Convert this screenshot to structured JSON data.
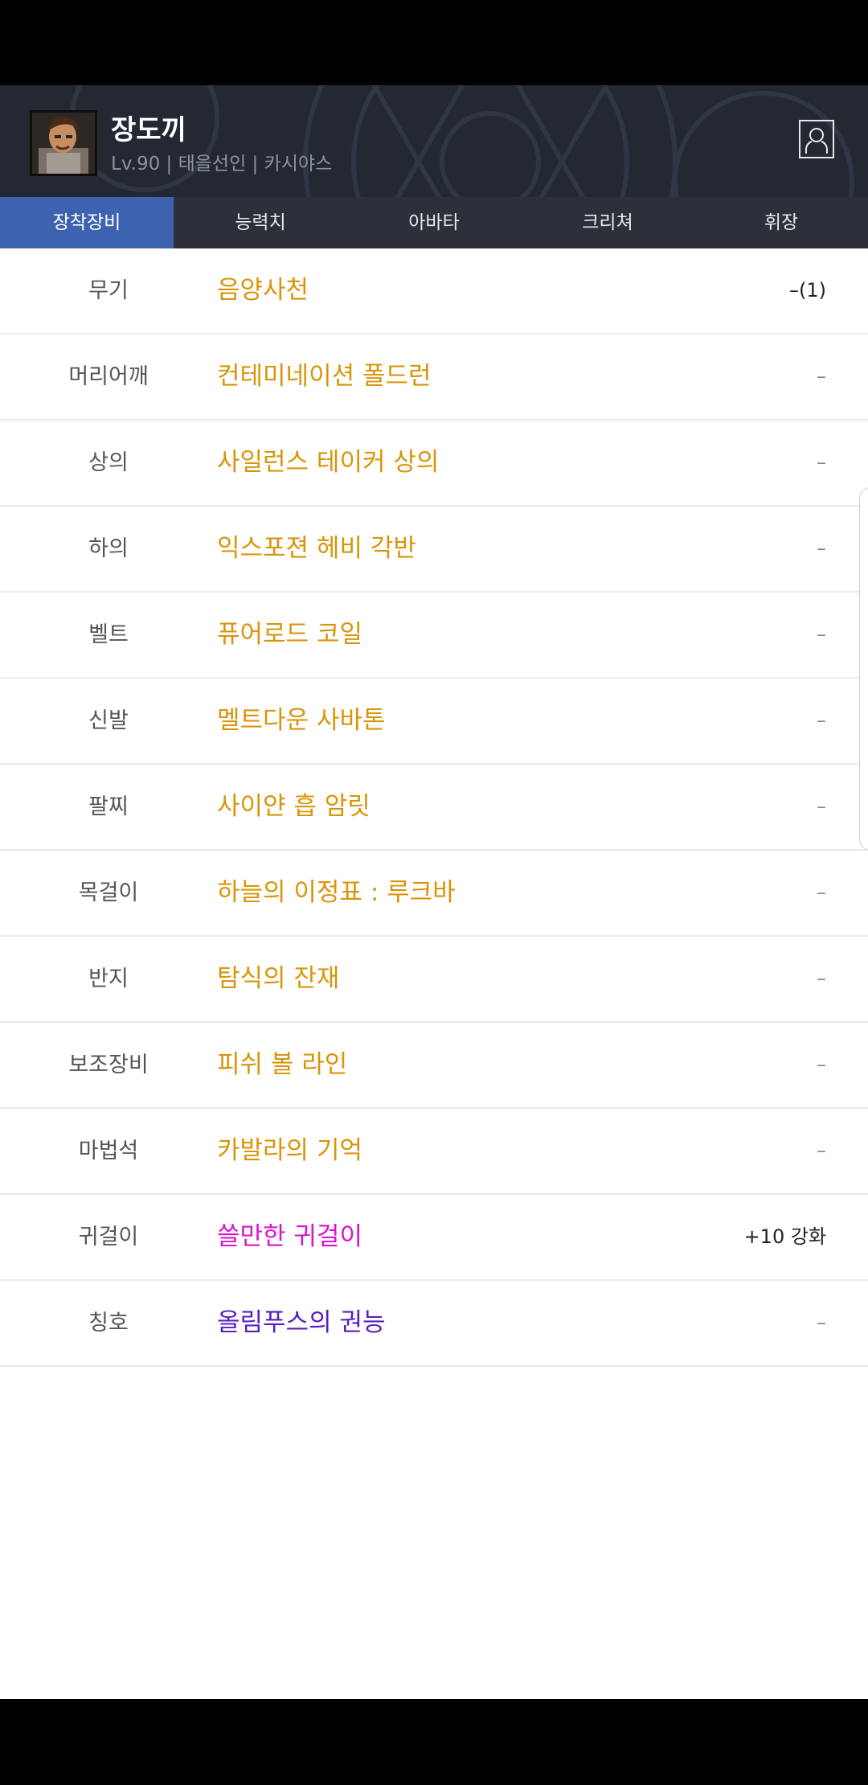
{
  "header": {
    "name": "장도끼",
    "meta": "Lv.90 | 태을선인 | 카시야스"
  },
  "tabs": [
    {
      "label": "장착장비",
      "active": true
    },
    {
      "label": "능력치",
      "active": false
    },
    {
      "label": "아바타",
      "active": false
    },
    {
      "label": "크리쳐",
      "active": false
    },
    {
      "label": "휘장",
      "active": false
    }
  ],
  "colors": {
    "header_bg": "#232833",
    "tab_active": "#3d62b0",
    "item_unique": "#d8950a",
    "item_rare": "#d616c8",
    "item_legendary": "#5a1fc0"
  },
  "equipment": [
    {
      "slot": "무기",
      "item": "음양사천",
      "extra": "–(1)",
      "color": "#d8950a"
    },
    {
      "slot": "머리어깨",
      "item": "컨테미네이션 폴드런",
      "extra": "–",
      "color": "#d8950a"
    },
    {
      "slot": "상의",
      "item": "사일런스 테이커 상의",
      "extra": "–",
      "color": "#d8950a"
    },
    {
      "slot": "하의",
      "item": "익스포젼 헤비 각반",
      "extra": "–",
      "color": "#d8950a"
    },
    {
      "slot": "벨트",
      "item": "퓨어로드 코일",
      "extra": "–",
      "color": "#d8950a"
    },
    {
      "slot": "신발",
      "item": "멜트다운 사바톤",
      "extra": "–",
      "color": "#d8950a"
    },
    {
      "slot": "팔찌",
      "item": "사이얀 흡 암릿",
      "extra": "–",
      "color": "#d8950a"
    },
    {
      "slot": "목걸이",
      "item": "하늘의 이정표 : 루크바",
      "extra": "–",
      "color": "#d8950a"
    },
    {
      "slot": "반지",
      "item": "탐식의 잔재",
      "extra": "–",
      "color": "#d8950a"
    },
    {
      "slot": "보조장비",
      "item": "피쉬 볼 라인",
      "extra": "–",
      "color": "#d8950a"
    },
    {
      "slot": "마법석",
      "item": "카발라의 기억",
      "extra": "–",
      "color": "#d8950a"
    },
    {
      "slot": "귀걸이",
      "item": "쓸만한 귀걸이",
      "extra": "+10 강화",
      "color": "#d616c8"
    },
    {
      "slot": "칭호",
      "item": "올림푸스의 권능",
      "extra": "–",
      "color": "#5a1fc0"
    }
  ]
}
